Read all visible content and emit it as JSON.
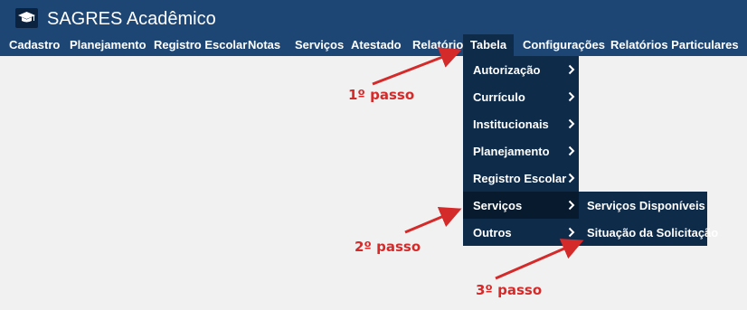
{
  "app": {
    "title": "SAGRES Acadêmico",
    "logo_icon": "graduation-cap-icon"
  },
  "nav": {
    "items": [
      {
        "label": "Cadastro"
      },
      {
        "label": "Planejamento"
      },
      {
        "label": "Registro Escolar"
      },
      {
        "label": "Notas"
      },
      {
        "label": "Serviços"
      },
      {
        "label": "Atestado"
      },
      {
        "label": "Relatório"
      },
      {
        "label": "Tabela",
        "active": true
      },
      {
        "label": "Configurações"
      },
      {
        "label": "Relatórios Particulares"
      }
    ]
  },
  "dropdown": {
    "items": [
      {
        "label": "Autorização"
      },
      {
        "label": "Currículo"
      },
      {
        "label": "Institucionais"
      },
      {
        "label": "Planejamento"
      },
      {
        "label": "Registro Escolar"
      },
      {
        "label": "Serviços",
        "hovered": true
      },
      {
        "label": "Outros"
      }
    ],
    "chevron_icon": "chevron-right-icon"
  },
  "submenu": {
    "items": [
      {
        "label": "Serviços Disponíveis"
      },
      {
        "label": "Situação da Solicitação"
      }
    ]
  },
  "annotations": {
    "step1": "1º passo",
    "step2": "2º passo",
    "step3": "3º passo",
    "color": "#d42a2a"
  },
  "colors": {
    "topbar": "#1d4674",
    "menu": "#0e2b4a",
    "menu_hover": "#071a2e",
    "background": "#f1f1f1"
  }
}
